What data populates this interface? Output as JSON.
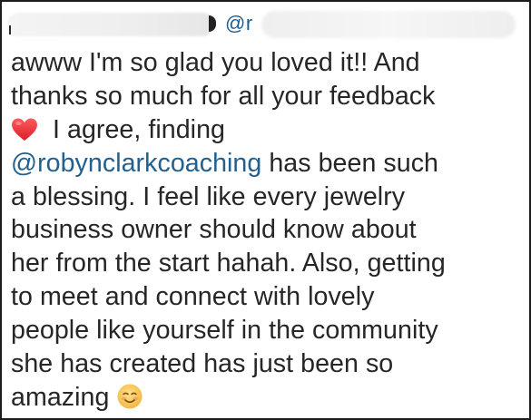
{
  "header": {
    "mention_prefix": "@r"
  },
  "message": {
    "lines": [
      "awww I'm so glad you loved it!! And",
      "thanks so much for all your feedback",
      "I agree, finding",
      "@robynclarkcoaching",
      "has been such",
      "a blessing. I feel like every jewelry",
      "business owner should know about",
      "her from the start hahah. Also, getting",
      "to meet and connect with lovely",
      "people like yourself in the community",
      "she has created has just been so",
      "amazing"
    ]
  },
  "icons": {
    "heart": "red-heart-emoji",
    "smile": "smiling-face-emoji"
  },
  "colors": {
    "text": "#262626",
    "mention": "#22608f",
    "heart": "#e8242c",
    "emoji_face": "#f5c542"
  }
}
